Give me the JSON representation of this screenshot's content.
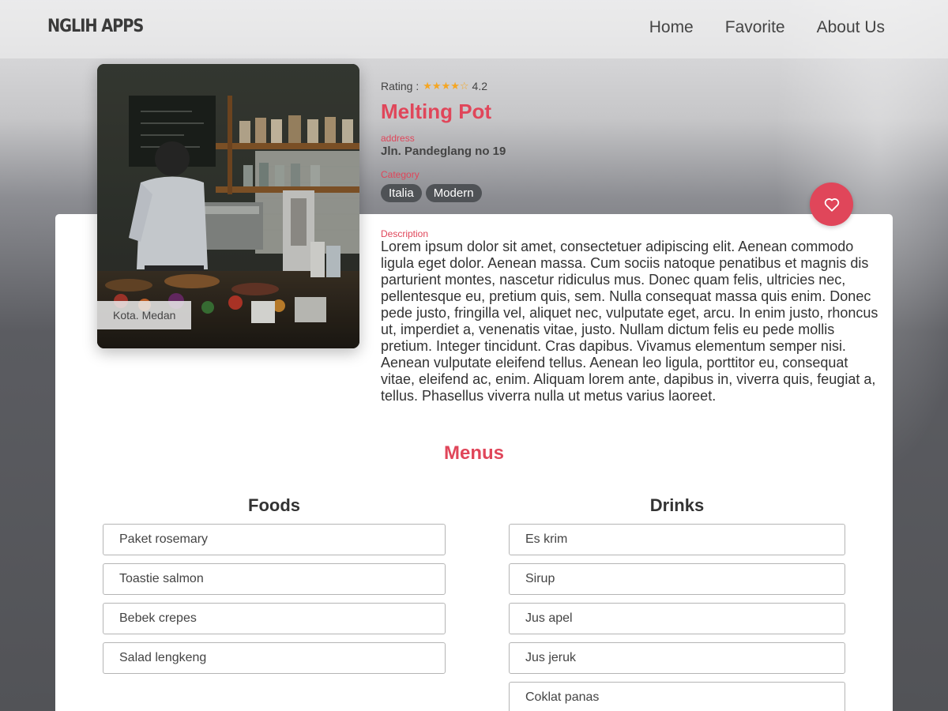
{
  "header": {
    "brand": "NGLIH APPS",
    "nav": [
      "Home",
      "Favorite",
      "About Us"
    ]
  },
  "restaurant": {
    "city": "Kota. Medan",
    "rating_label": "Rating :",
    "rating_value": "4.2",
    "rating": 4.2,
    "name": "Melting Pot",
    "address_label": "address",
    "address": "Jln. Pandeglang no 19",
    "category_label": "Category",
    "categories": [
      "Italia",
      "Modern"
    ],
    "description_label": "Description",
    "description": "Lorem ipsum dolor sit amet, consectetuer adipiscing elit. Aenean commodo ligula eget dolor. Aenean massa. Cum sociis natoque penatibus et magnis dis parturient montes, nascetur ridiculus mus. Donec quam felis, ultricies nec, pellentesque eu, pretium quis, sem. Nulla consequat massa quis enim. Donec pede justo, fringilla vel, aliquet nec, vulputate eget, arcu. In enim justo, rhoncus ut, imperdiet a, venenatis vitae, justo. Nullam dictum felis eu pede mollis pretium. Integer tincidunt. Cras dapibus. Vivamus elementum semper nisi. Aenean vulputate eleifend tellus. Aenean leo ligula, porttitor eu, consequat vitae, eleifend ac, enim. Aliquam lorem ante, dapibus in, viverra quis, feugiat a, tellus. Phasellus viverra nulla ut metus varius laoreet."
  },
  "menus": {
    "title": "Menus",
    "foods_title": "Foods",
    "foods": [
      "Paket rosemary",
      "Toastie salmon",
      "Bebek crepes",
      "Salad lengkeng"
    ],
    "drinks_title": "Drinks",
    "drinks": [
      "Es krim",
      "Sirup",
      "Jus apel",
      "Jus jeruk",
      "Coklat panas"
    ]
  },
  "colors": {
    "accent": "#e0465a",
    "star": "#f5a623",
    "chip": "#4f5256"
  },
  "icons": {
    "favorite": "heart-outline-icon",
    "star": "star-icon"
  }
}
